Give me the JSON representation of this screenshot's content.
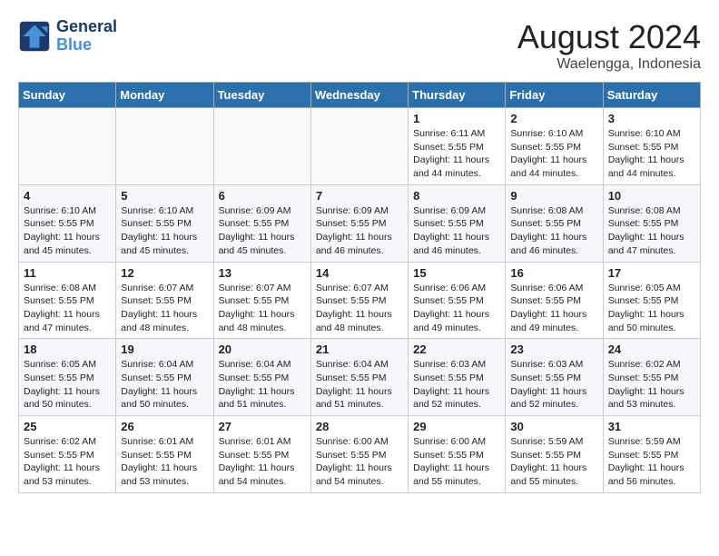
{
  "header": {
    "logo_line1": "General",
    "logo_line2": "Blue",
    "month": "August 2024",
    "location": "Waelengga, Indonesia"
  },
  "weekdays": [
    "Sunday",
    "Monday",
    "Tuesday",
    "Wednesday",
    "Thursday",
    "Friday",
    "Saturday"
  ],
  "weeks": [
    [
      {
        "day": "",
        "info": ""
      },
      {
        "day": "",
        "info": ""
      },
      {
        "day": "",
        "info": ""
      },
      {
        "day": "",
        "info": ""
      },
      {
        "day": "1",
        "sunrise": "Sunrise: 6:11 AM",
        "sunset": "Sunset: 5:55 PM",
        "daylight": "Daylight: 11 hours and 44 minutes."
      },
      {
        "day": "2",
        "sunrise": "Sunrise: 6:10 AM",
        "sunset": "Sunset: 5:55 PM",
        "daylight": "Daylight: 11 hours and 44 minutes."
      },
      {
        "day": "3",
        "sunrise": "Sunrise: 6:10 AM",
        "sunset": "Sunset: 5:55 PM",
        "daylight": "Daylight: 11 hours and 44 minutes."
      }
    ],
    [
      {
        "day": "4",
        "sunrise": "Sunrise: 6:10 AM",
        "sunset": "Sunset: 5:55 PM",
        "daylight": "Daylight: 11 hours and 45 minutes."
      },
      {
        "day": "5",
        "sunrise": "Sunrise: 6:10 AM",
        "sunset": "Sunset: 5:55 PM",
        "daylight": "Daylight: 11 hours and 45 minutes."
      },
      {
        "day": "6",
        "sunrise": "Sunrise: 6:09 AM",
        "sunset": "Sunset: 5:55 PM",
        "daylight": "Daylight: 11 hours and 45 minutes."
      },
      {
        "day": "7",
        "sunrise": "Sunrise: 6:09 AM",
        "sunset": "Sunset: 5:55 PM",
        "daylight": "Daylight: 11 hours and 46 minutes."
      },
      {
        "day": "8",
        "sunrise": "Sunrise: 6:09 AM",
        "sunset": "Sunset: 5:55 PM",
        "daylight": "Daylight: 11 hours and 46 minutes."
      },
      {
        "day": "9",
        "sunrise": "Sunrise: 6:08 AM",
        "sunset": "Sunset: 5:55 PM",
        "daylight": "Daylight: 11 hours and 46 minutes."
      },
      {
        "day": "10",
        "sunrise": "Sunrise: 6:08 AM",
        "sunset": "Sunset: 5:55 PM",
        "daylight": "Daylight: 11 hours and 47 minutes."
      }
    ],
    [
      {
        "day": "11",
        "sunrise": "Sunrise: 6:08 AM",
        "sunset": "Sunset: 5:55 PM",
        "daylight": "Daylight: 11 hours and 47 minutes."
      },
      {
        "day": "12",
        "sunrise": "Sunrise: 6:07 AM",
        "sunset": "Sunset: 5:55 PM",
        "daylight": "Daylight: 11 hours and 48 minutes."
      },
      {
        "day": "13",
        "sunrise": "Sunrise: 6:07 AM",
        "sunset": "Sunset: 5:55 PM",
        "daylight": "Daylight: 11 hours and 48 minutes."
      },
      {
        "day": "14",
        "sunrise": "Sunrise: 6:07 AM",
        "sunset": "Sunset: 5:55 PM",
        "daylight": "Daylight: 11 hours and 48 minutes."
      },
      {
        "day": "15",
        "sunrise": "Sunrise: 6:06 AM",
        "sunset": "Sunset: 5:55 PM",
        "daylight": "Daylight: 11 hours and 49 minutes."
      },
      {
        "day": "16",
        "sunrise": "Sunrise: 6:06 AM",
        "sunset": "Sunset: 5:55 PM",
        "daylight": "Daylight: 11 hours and 49 minutes."
      },
      {
        "day": "17",
        "sunrise": "Sunrise: 6:05 AM",
        "sunset": "Sunset: 5:55 PM",
        "daylight": "Daylight: 11 hours and 50 minutes."
      }
    ],
    [
      {
        "day": "18",
        "sunrise": "Sunrise: 6:05 AM",
        "sunset": "Sunset: 5:55 PM",
        "daylight": "Daylight: 11 hours and 50 minutes."
      },
      {
        "day": "19",
        "sunrise": "Sunrise: 6:04 AM",
        "sunset": "Sunset: 5:55 PM",
        "daylight": "Daylight: 11 hours and 50 minutes."
      },
      {
        "day": "20",
        "sunrise": "Sunrise: 6:04 AM",
        "sunset": "Sunset: 5:55 PM",
        "daylight": "Daylight: 11 hours and 51 minutes."
      },
      {
        "day": "21",
        "sunrise": "Sunrise: 6:04 AM",
        "sunset": "Sunset: 5:55 PM",
        "daylight": "Daylight: 11 hours and 51 minutes."
      },
      {
        "day": "22",
        "sunrise": "Sunrise: 6:03 AM",
        "sunset": "Sunset: 5:55 PM",
        "daylight": "Daylight: 11 hours and 52 minutes."
      },
      {
        "day": "23",
        "sunrise": "Sunrise: 6:03 AM",
        "sunset": "Sunset: 5:55 PM",
        "daylight": "Daylight: 11 hours and 52 minutes."
      },
      {
        "day": "24",
        "sunrise": "Sunrise: 6:02 AM",
        "sunset": "Sunset: 5:55 PM",
        "daylight": "Daylight: 11 hours and 53 minutes."
      }
    ],
    [
      {
        "day": "25",
        "sunrise": "Sunrise: 6:02 AM",
        "sunset": "Sunset: 5:55 PM",
        "daylight": "Daylight: 11 hours and 53 minutes."
      },
      {
        "day": "26",
        "sunrise": "Sunrise: 6:01 AM",
        "sunset": "Sunset: 5:55 PM",
        "daylight": "Daylight: 11 hours and 53 minutes."
      },
      {
        "day": "27",
        "sunrise": "Sunrise: 6:01 AM",
        "sunset": "Sunset: 5:55 PM",
        "daylight": "Daylight: 11 hours and 54 minutes."
      },
      {
        "day": "28",
        "sunrise": "Sunrise: 6:00 AM",
        "sunset": "Sunset: 5:55 PM",
        "daylight": "Daylight: 11 hours and 54 minutes."
      },
      {
        "day": "29",
        "sunrise": "Sunrise: 6:00 AM",
        "sunset": "Sunset: 5:55 PM",
        "daylight": "Daylight: 11 hours and 55 minutes."
      },
      {
        "day": "30",
        "sunrise": "Sunrise: 5:59 AM",
        "sunset": "Sunset: 5:55 PM",
        "daylight": "Daylight: 11 hours and 55 minutes."
      },
      {
        "day": "31",
        "sunrise": "Sunrise: 5:59 AM",
        "sunset": "Sunset: 5:55 PM",
        "daylight": "Daylight: 11 hours and 56 minutes."
      }
    ]
  ]
}
